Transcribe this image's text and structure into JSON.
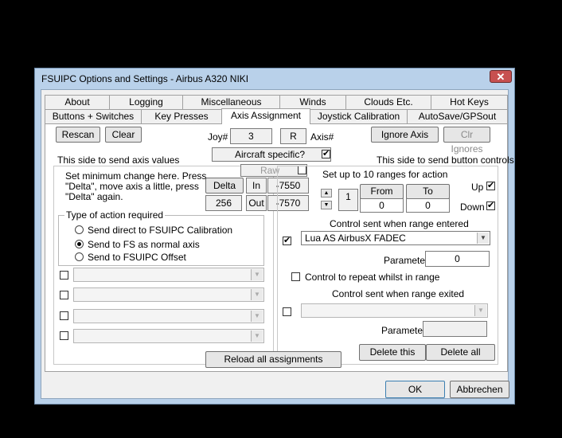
{
  "window": {
    "title": "FSUIPC Options and Settings - Airbus A320 NIKI",
    "close_glyph": "✕"
  },
  "tabs": {
    "row1": [
      "About",
      "Logging",
      "Miscellaneous",
      "Winds",
      "Clouds Etc.",
      "Hot Keys"
    ],
    "row2": [
      "Buttons + Switches",
      "Key Presses",
      "Axis Assignment",
      "Joystick Calibration",
      "AutoSave/GPSout"
    ],
    "active": "Axis Assignment"
  },
  "top": {
    "rescan": "Rescan",
    "clear": "Clear",
    "joy_label": "Joy#",
    "joy_value": "3",
    "axis_value": "R",
    "axis_label": "Axis#",
    "ignore_axis": "Ignore Axis",
    "clr_ignores": "Clr Ignores"
  },
  "left": {
    "side_heading": "This side to send axis values",
    "aircraft_specific": "Aircraft specific?",
    "aircraft_specific_checked": true,
    "raw": "Raw",
    "info_line1": "Set minimum change  here.  Press",
    "info_line2": "\"Delta\", move axis a little,  press",
    "info_line3": "\"Delta\" again.",
    "delta_button": "Delta",
    "delta_value": "256",
    "in_label": "In",
    "in_value": "-7550",
    "out_label": "Out",
    "out_value": "-7570",
    "action_group": "Type of action required",
    "radios": [
      {
        "label": "Send direct to FSUIPC Calibration",
        "selected": false
      },
      {
        "label": "Send to FS as normal axis",
        "selected": true
      },
      {
        "label": "Send to FSUIPC Offset",
        "selected": false
      }
    ]
  },
  "right": {
    "side_heading": "This side to send button controls",
    "ranges_label": "Set up to 10 ranges for action",
    "range_index": "1",
    "from_button": "From",
    "to_button": "To",
    "from_value": "0",
    "to_value": "0",
    "up_label": "Up",
    "up_checked": true,
    "down_label": "Down",
    "down_checked": true,
    "entered_label": "Control sent when range entered",
    "entered_control": "Lua AS AirbusX FADEC",
    "entered_checked": true,
    "parameter_label": "Parameter",
    "parameter_value": "0",
    "repeat_label": "Control to repeat whilst in range",
    "exited_label": "Control sent when range exited",
    "parameter2_label": "Parameter",
    "parameter2_value": "",
    "delete_this": "Delete this",
    "delete_all": "Delete all"
  },
  "bottom": {
    "reload": "Reload all assignments",
    "ok": "OK",
    "cancel": "Abbrechen"
  }
}
